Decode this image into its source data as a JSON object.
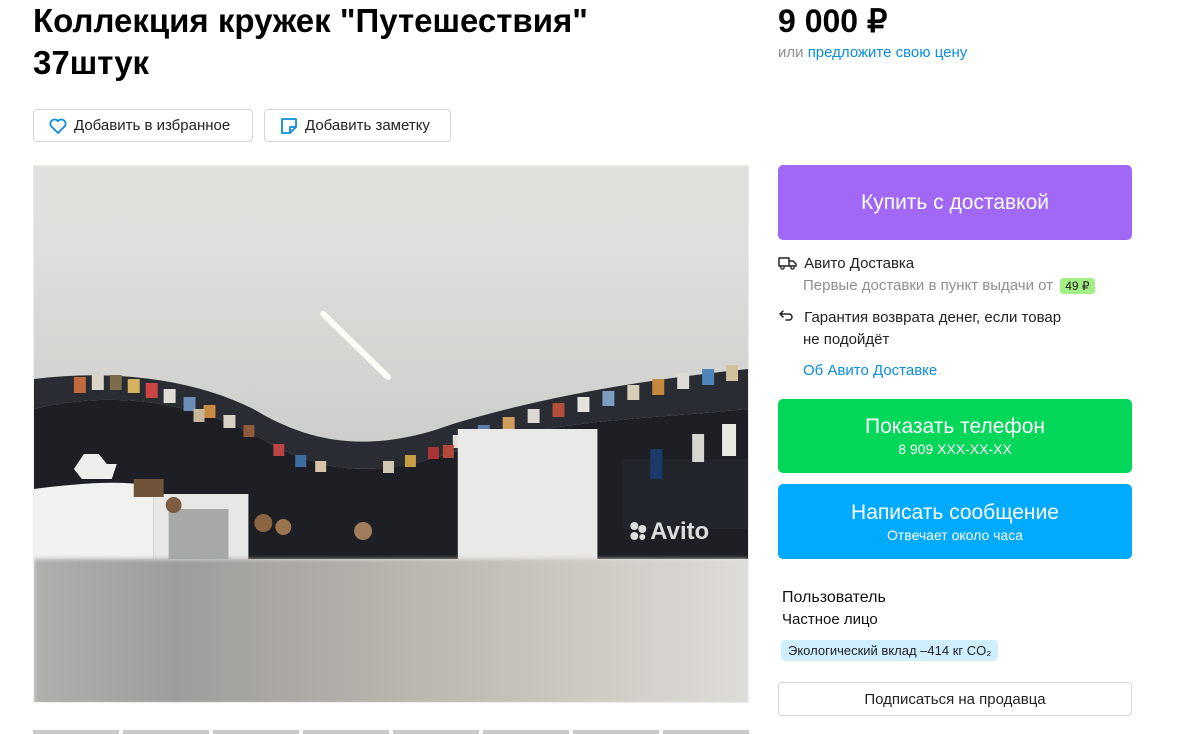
{
  "listing": {
    "title": "Коллекция кружек \"Путешествия\" 37штук",
    "price": "9 000 ₽",
    "offer_prefix": "или ",
    "offer_link": "предложите свою цену"
  },
  "actions": {
    "favorite_label": "Добавить в избранное",
    "note_label": "Добавить заметку"
  },
  "photo": {
    "watermark": "Avito"
  },
  "delivery": {
    "buy_label": "Купить с доставкой",
    "service_title": "Авито Доставка",
    "service_sub": "Первые доставки в пункт выдачи от",
    "service_price": "49 ₽",
    "guarantee_line1": "Гарантия возврата денег, если товар",
    "guarantee_line2": "не подойдёт",
    "about_link": "Об Авито Доставке"
  },
  "contact": {
    "phone_label": "Показать телефон",
    "phone_number": "8 909 XXX-XX-XX",
    "message_label": "Написать сообщение",
    "message_sub": "Отвечает около часа"
  },
  "seller": {
    "name": "Пользователь",
    "type": "Частное лицо",
    "eco_badge": "Экологический вклад –414 кг CO₂",
    "subscribe_label": "Подписаться на продавца"
  },
  "colors": {
    "buy": "#a168f6",
    "phone": "#03d75a",
    "message": "#00aaff",
    "link": "#0a8edb"
  }
}
